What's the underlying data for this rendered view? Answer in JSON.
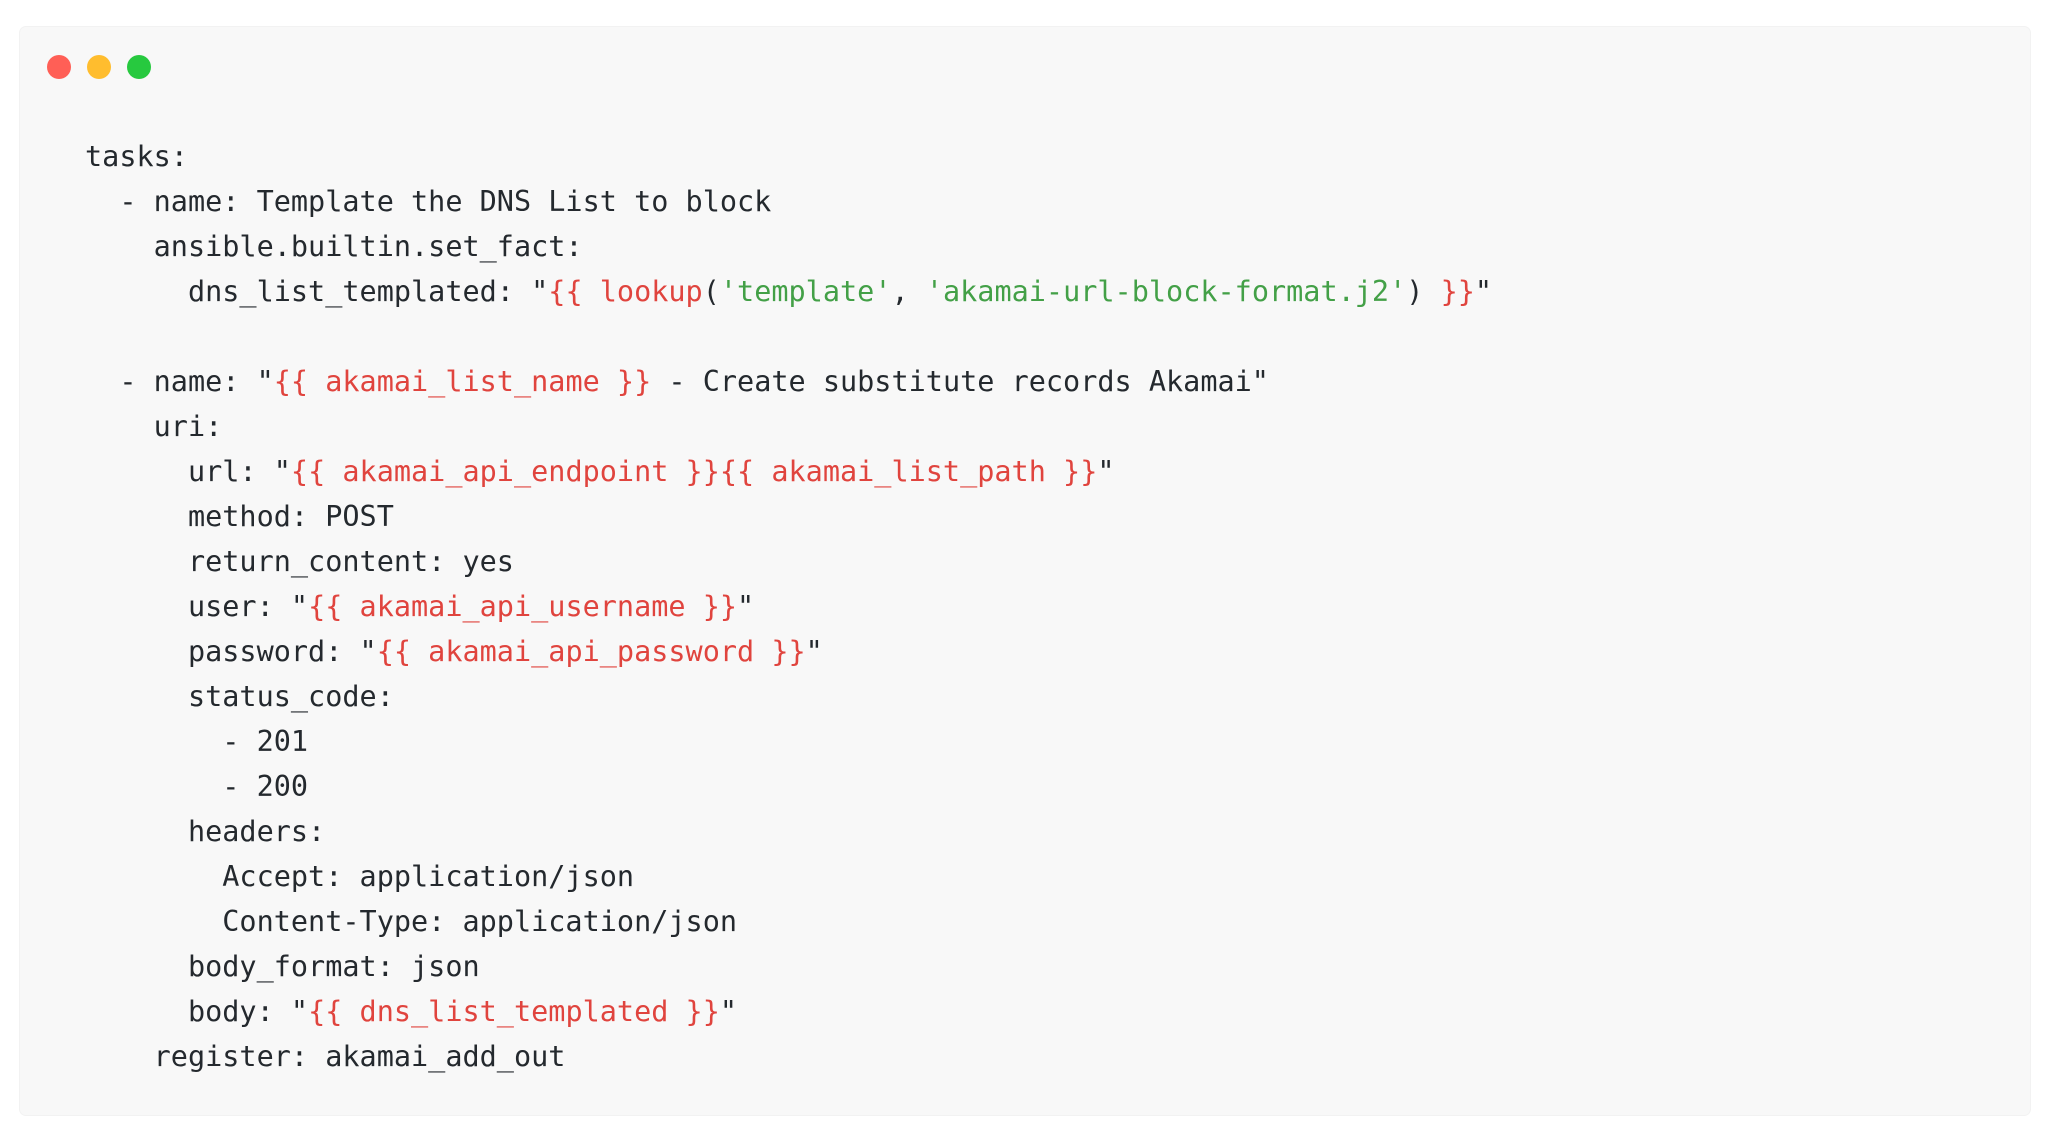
{
  "colors": {
    "window_bg": "#f8f8f8",
    "text": "#24292e",
    "template_expr": "#e0443e",
    "string_literal": "#43a047",
    "close": "#ff5f56",
    "minimize": "#ffbd2e",
    "maximize": "#27c93f"
  },
  "window_controls": [
    "close",
    "minimize",
    "maximize"
  ],
  "code": {
    "language": "yaml",
    "lines": [
      [
        {
          "t": "tasks:"
        }
      ],
      [
        {
          "t": "  - name: Template the DNS List to block"
        }
      ],
      [
        {
          "t": "    ansible.builtin.set_fact:"
        }
      ],
      [
        {
          "t": "      dns_list_templated: \""
        },
        {
          "t": "{{ lookup",
          "c": "expr"
        },
        {
          "t": "("
        },
        {
          "t": "'template'",
          "c": "str"
        },
        {
          "t": ", "
        },
        {
          "t": "'akamai-url-block-format.j2'",
          "c": "str"
        },
        {
          "t": ") "
        },
        {
          "t": "}}",
          "c": "expr"
        },
        {
          "t": "\""
        }
      ],
      [
        {
          "t": ""
        }
      ],
      [
        {
          "t": "  - name: \""
        },
        {
          "t": "{{ akamai_list_name }}",
          "c": "expr"
        },
        {
          "t": " - Create substitute records Akamai\""
        }
      ],
      [
        {
          "t": "    uri:"
        }
      ],
      [
        {
          "t": "      url: \""
        },
        {
          "t": "{{ akamai_api_endpoint }}{{ akamai_list_path }}",
          "c": "expr"
        },
        {
          "t": "\""
        }
      ],
      [
        {
          "t": "      method: POST"
        }
      ],
      [
        {
          "t": "      return_content: yes"
        }
      ],
      [
        {
          "t": "      user: \""
        },
        {
          "t": "{{ akamai_api_username }}",
          "c": "expr"
        },
        {
          "t": "\""
        }
      ],
      [
        {
          "t": "      password: \""
        },
        {
          "t": "{{ akamai_api_password }}",
          "c": "expr"
        },
        {
          "t": "\""
        }
      ],
      [
        {
          "t": "      status_code:"
        }
      ],
      [
        {
          "t": "        - 201"
        }
      ],
      [
        {
          "t": "        - 200"
        }
      ],
      [
        {
          "t": "      headers:"
        }
      ],
      [
        {
          "t": "        Accept: application/json"
        }
      ],
      [
        {
          "t": "        Content-Type: application/json"
        }
      ],
      [
        {
          "t": "      body_format: json"
        }
      ],
      [
        {
          "t": "      body: \""
        },
        {
          "t": "{{ dns_list_templated }}",
          "c": "expr"
        },
        {
          "t": "\""
        }
      ],
      [
        {
          "t": "    register: akamai_add_out"
        }
      ]
    ]
  }
}
